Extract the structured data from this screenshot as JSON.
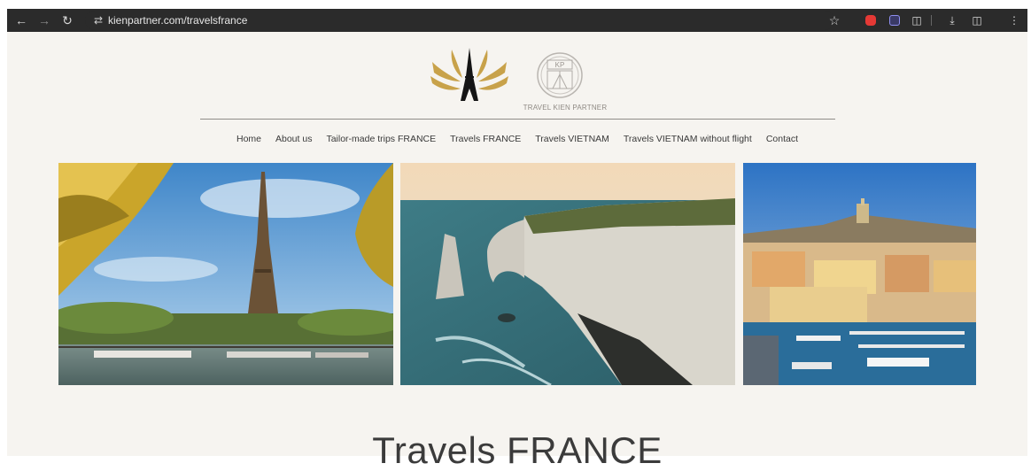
{
  "browser": {
    "url": "kienpartner.com/travelsfrance",
    "icons": {
      "back": "back-arrow-icon",
      "forward": "forward-arrow-icon",
      "reload": "reload-icon",
      "site_settings": "tune-icon",
      "bookmark": "star-icon",
      "download": "download-icon",
      "side_panel": "side-panel-icon",
      "more": "more-vertical-icon"
    }
  },
  "header": {
    "brand_name": "TRAVEL KIEN PARTNER",
    "badge_letters": "KP"
  },
  "nav": {
    "items": [
      {
        "label": "Home"
      },
      {
        "label": "About us"
      },
      {
        "label": "Tailor-made trips FRANCE"
      },
      {
        "label": "Travels FRANCE"
      },
      {
        "label": "Travels VIETNAM"
      },
      {
        "label": "Travels VIETNAM without flight"
      },
      {
        "label": "Contact"
      }
    ]
  },
  "gallery": {
    "photos": [
      {
        "subject": "eiffel-tower-paris"
      },
      {
        "subject": "etretat-cliffs"
      },
      {
        "subject": "marseille-old-port"
      }
    ]
  },
  "main": {
    "page_title": "Travels FRANCE"
  },
  "colors": {
    "page_background": "#f6f4f0",
    "logo_gold": "#c8a24a",
    "text": "#3b3b3b"
  }
}
